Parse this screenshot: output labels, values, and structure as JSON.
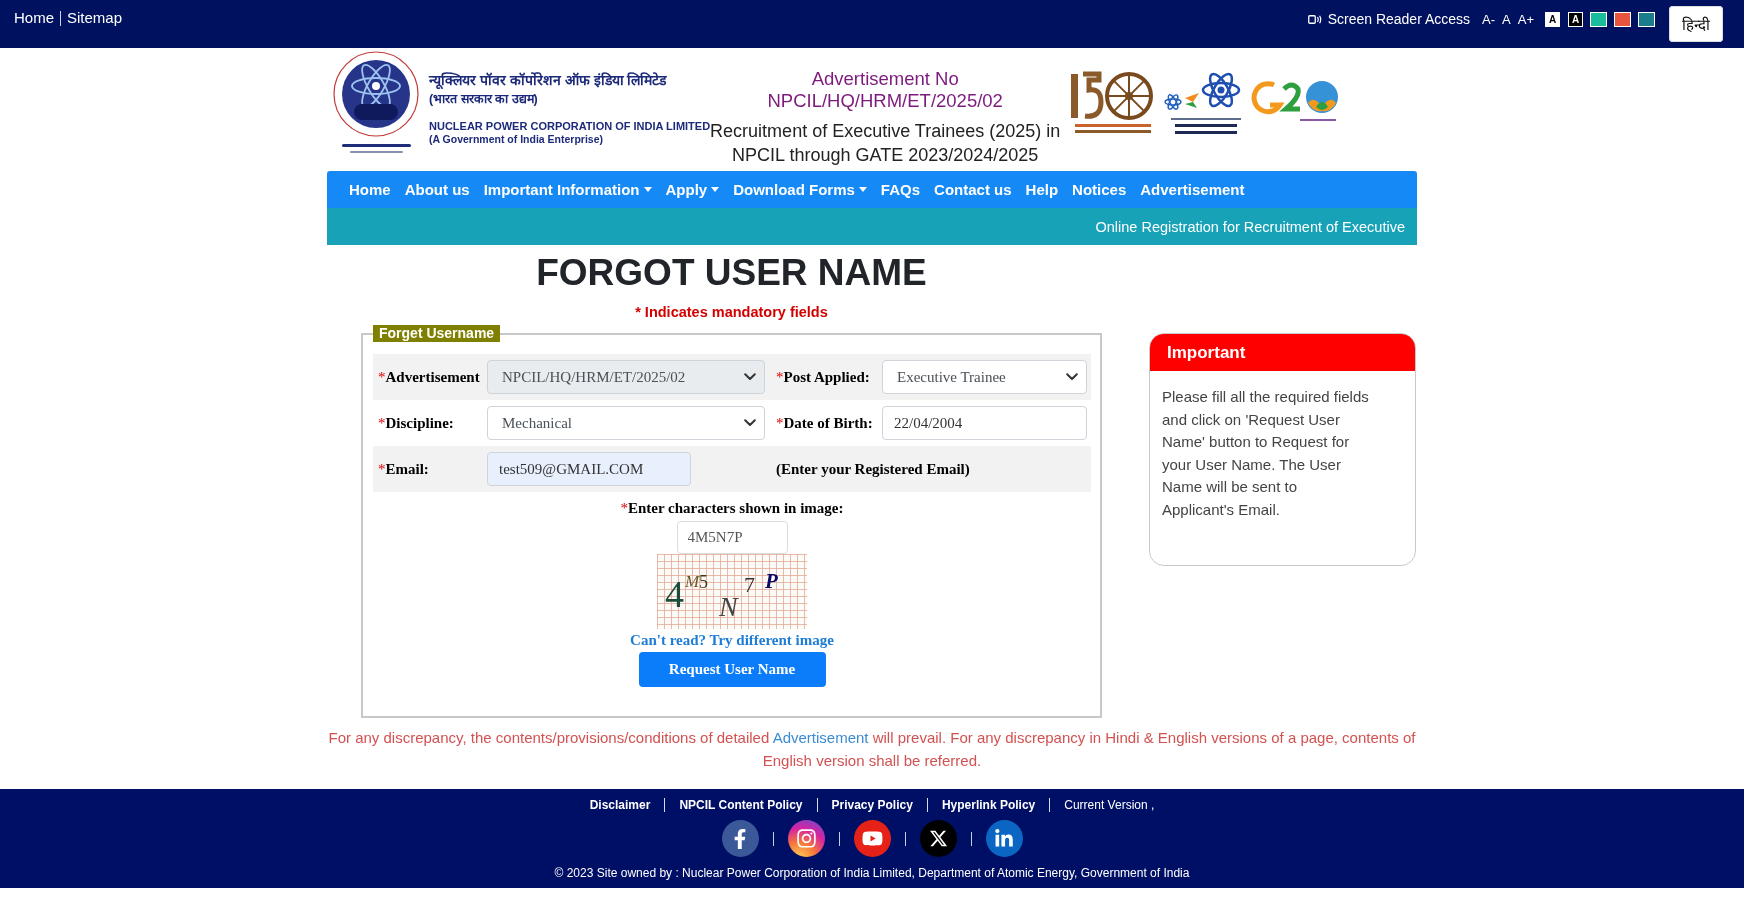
{
  "top_bar": {
    "links": [
      "Home",
      "Sitemap"
    ],
    "screen_reader_link": "Screen Reader Access",
    "font_size_buttons": [
      "A-",
      "A",
      "A+"
    ],
    "contrast_buttons": [
      {
        "label": "A",
        "kind": "light"
      },
      {
        "label": "A",
        "kind": "dark"
      }
    ],
    "theme_swatches": [
      {
        "color": "#1abc9c"
      },
      {
        "color": "#e8553e"
      },
      {
        "color": "#1b7d8c"
      }
    ],
    "language_button": "हिन्दी"
  },
  "header": {
    "org_name_hindi": "न्यूक्लियर पॉवर कॉर्पोरेशन ऑफ इंडिया लिमिटेड",
    "org_tagline_hindi": "(भारत सरकार का उद्यम)",
    "org_name": "NUCLEAR POWER CORPORATION OF INDIA LIMITED",
    "org_tagline": "(A Government of India Enterprise)",
    "advertisement_label": "Advertisement No",
    "advertisement_number": "NPCIL/HQ/HRM/ET/2025/02",
    "recruitment_title": [
      "Recruitment of Executive Trainees (2025) in",
      "NPCIL through GATE 2023/2024/2025"
    ]
  },
  "nav": {
    "items": [
      {
        "label": "Home",
        "dropdown": false
      },
      {
        "label": "About us",
        "dropdown": false
      },
      {
        "label": "Important Information",
        "dropdown": true
      },
      {
        "label": "Apply",
        "dropdown": true
      },
      {
        "label": "Download Forms",
        "dropdown": true
      },
      {
        "label": "FAQs",
        "dropdown": false
      },
      {
        "label": "Contact us",
        "dropdown": false
      },
      {
        "label": "Help",
        "dropdown": false
      },
      {
        "label": "Notices",
        "dropdown": false
      },
      {
        "label": "Advertisement",
        "dropdown": false
      }
    ]
  },
  "ticker": "Online Registration for Recruitment of Executive",
  "page_title": "FORGOT USER NAME",
  "mandatory_note": "* Indicates mandatory fields",
  "form": {
    "legend": "Forget Username",
    "rows": [
      {
        "fields": [
          {
            "kind": "select",
            "mark": "*",
            "label": "Advertisement",
            "value": "NPCIL/HQ/HRM/ET/2025/02",
            "disabled": true
          },
          {
            "kind": "select",
            "mark": "*",
            "label": "Post Applied:",
            "value": "Executive Trainee",
            "disabled": false
          }
        ]
      },
      {
        "fields": [
          {
            "kind": "select",
            "mark": "*",
            "label": "Discipline:",
            "value": "Mechanical",
            "disabled": false
          },
          {
            "kind": "input",
            "mark": "*",
            "label": "Date of Birth:",
            "value": "22/04/2004",
            "autofilled": false
          }
        ]
      },
      {
        "fields": [
          {
            "kind": "input",
            "mark": "*",
            "label": "Email:",
            "value": "test509@GMAIL.COM",
            "autofilled": true
          },
          {
            "kind": "hint",
            "text": "(Enter your Registered Email)"
          }
        ]
      }
    ],
    "captcha": {
      "mark": "*",
      "label": "Enter characters shown in image:",
      "value": "4M5N7P",
      "image_glyphs": [
        "4",
        "M",
        "5",
        "N",
        "7",
        "P"
      ],
      "refresh_link": "Can't read? Try different image"
    },
    "submit_button": "Request User Name"
  },
  "important": {
    "title": "Important",
    "text": "Please fill all the required fields and click on 'Request User Name' button to Request for your User Name. The User Name will be sent to Applicant's Email."
  },
  "disclaimer": {
    "before_link": "For any discrepancy, the contents/provisions/conditions of detailed",
    "link": "Advertisement",
    "after_link": "will prevail. For any discrepancy in Hindi & English versions of a page, contents of English version shall be referred."
  },
  "footer": {
    "links": [
      {
        "label": "Disclaimer",
        "kind": "link"
      },
      {
        "label": "NPCIL Content Policy",
        "kind": "link"
      },
      {
        "label": "Privacy Policy",
        "kind": "link"
      },
      {
        "label": "Hyperlink Policy",
        "kind": "link"
      },
      {
        "label": "Current Version ,",
        "kind": "text"
      }
    ],
    "social": [
      {
        "kind": "facebook"
      },
      {
        "kind": "instagram"
      },
      {
        "kind": "youtube"
      },
      {
        "kind": "x"
      },
      {
        "kind": "linkedin"
      }
    ],
    "copyright": "© 2023 Site owned by : Nuclear Power Corporation of India Limited, Department of Atomic Energy, Government of India"
  }
}
